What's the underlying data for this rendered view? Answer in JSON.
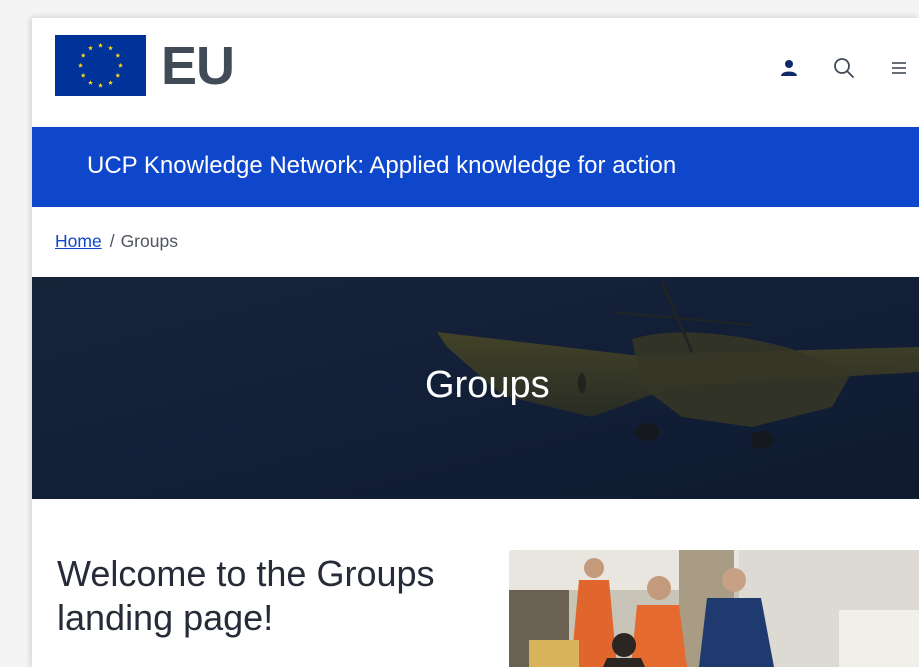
{
  "header": {
    "logo_text": "EU",
    "icons": [
      "user-icon",
      "search-icon",
      "menu-icon"
    ]
  },
  "site_banner": {
    "title": "UCP Knowledge Network: Applied knowledge for action"
  },
  "breadcrumb": {
    "home": "Home",
    "separator": "/",
    "current": "Groups"
  },
  "hero": {
    "title": "Groups"
  },
  "main": {
    "welcome_heading": "Welcome to the Groups landing page!"
  },
  "colors": {
    "brand_blue": "#0e47cb",
    "eu_flag_blue": "#003399",
    "eu_star_yellow": "#ffd617",
    "hero_dark": "#17253a",
    "text_dark": "#262b38"
  }
}
